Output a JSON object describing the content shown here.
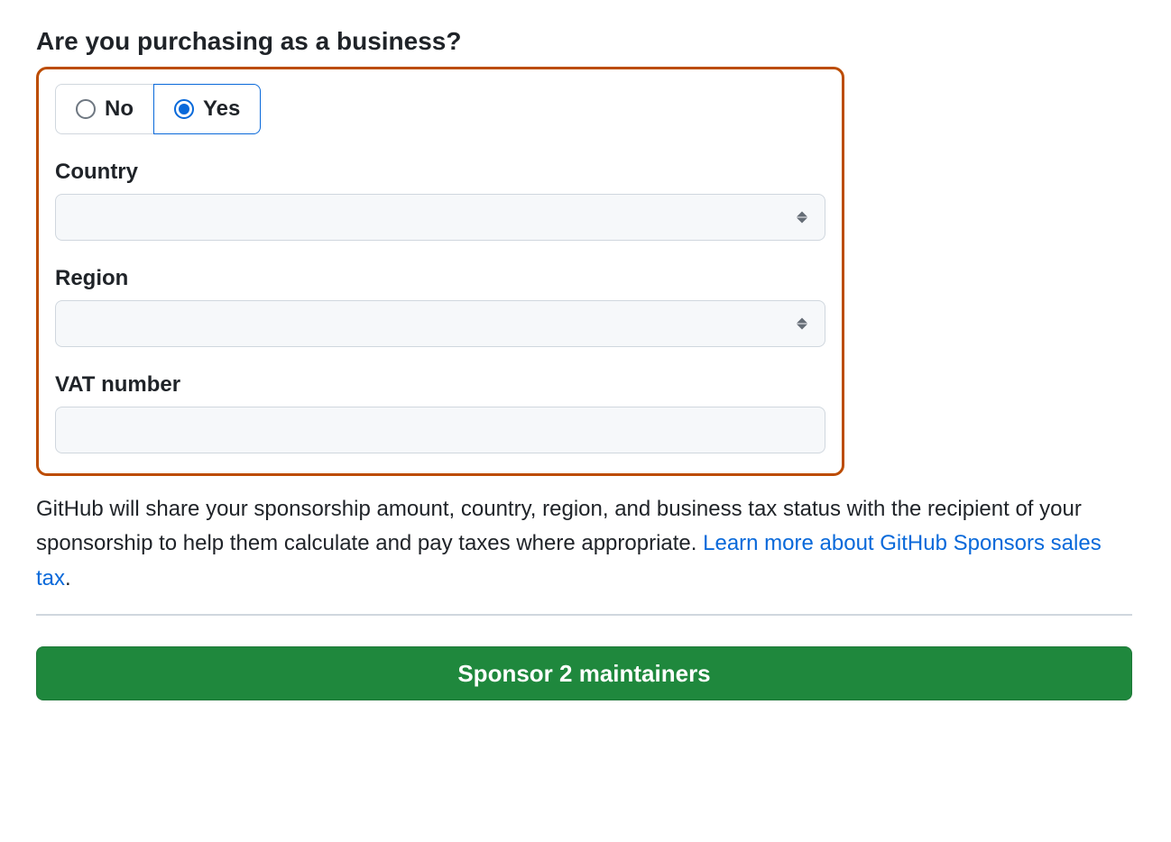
{
  "heading": "Are you purchasing as a business?",
  "toggle": {
    "no_label": "No",
    "yes_label": "Yes",
    "selected": "yes"
  },
  "fields": {
    "country_label": "Country",
    "country_value": "",
    "region_label": "Region",
    "region_value": "",
    "vat_label": "VAT number",
    "vat_value": ""
  },
  "info": {
    "text_before": "GitHub will share your sponsorship amount, country, region, and business tax status with the recipient of your sponsorship to help them calculate and pay taxes where appropriate. ",
    "link_text": "Learn more about GitHub Sponsors sales tax",
    "text_after": "."
  },
  "cta_label": "Sponsor 2 maintainers"
}
